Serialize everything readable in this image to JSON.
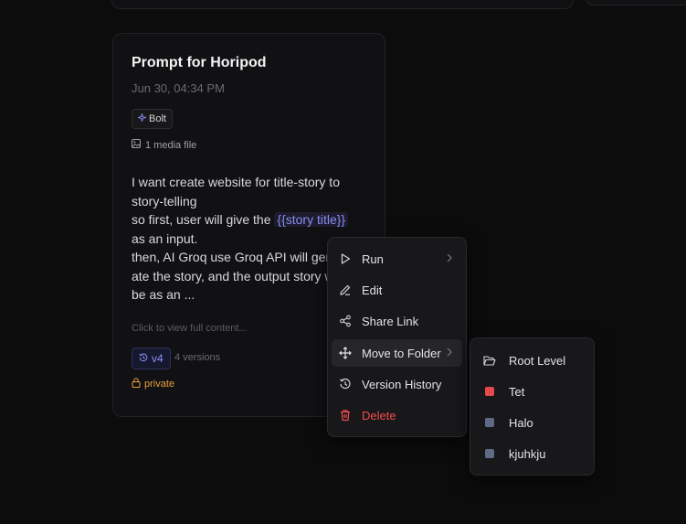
{
  "card": {
    "title": "Prompt for Horipod",
    "date": "Jun 30, 04:34 PM",
    "tag": "Bolt",
    "media": "1 media file",
    "lines": [
      "I want create website for title-story to",
      "story-telling",
      "so first, user will give the ",
      "as an input.",
      "then, AI Groq use Groq API will gener",
      "ate the story, and the output story will",
      "be as an ..."
    ],
    "variable": "{{story title}}",
    "click_hint": "Click to view full content...",
    "version": "v4",
    "versions_count": "4 versions",
    "visibility": "private"
  },
  "menu": {
    "items": [
      {
        "label": "Run",
        "icon": "play-icon"
      },
      {
        "label": "Edit",
        "icon": "pencil-icon"
      },
      {
        "label": "Share Link",
        "icon": "share-icon"
      },
      {
        "label": "Move to Folder",
        "icon": "move-icon"
      },
      {
        "label": "Version History",
        "icon": "history-icon"
      },
      {
        "label": "Delete",
        "icon": "trash-icon"
      }
    ]
  },
  "submenu": {
    "items": [
      {
        "label": "Root Level",
        "icon": "folder-open-icon"
      },
      {
        "label": "Tet",
        "color": "#e5484d"
      },
      {
        "label": "Halo",
        "color": "#5f6b85"
      },
      {
        "label": "kjuhkju",
        "color": "#5f6b85"
      }
    ]
  },
  "colors": {
    "accent": "#8a8cf0",
    "private": "#e5a23c",
    "danger": "#ef4c4c"
  }
}
